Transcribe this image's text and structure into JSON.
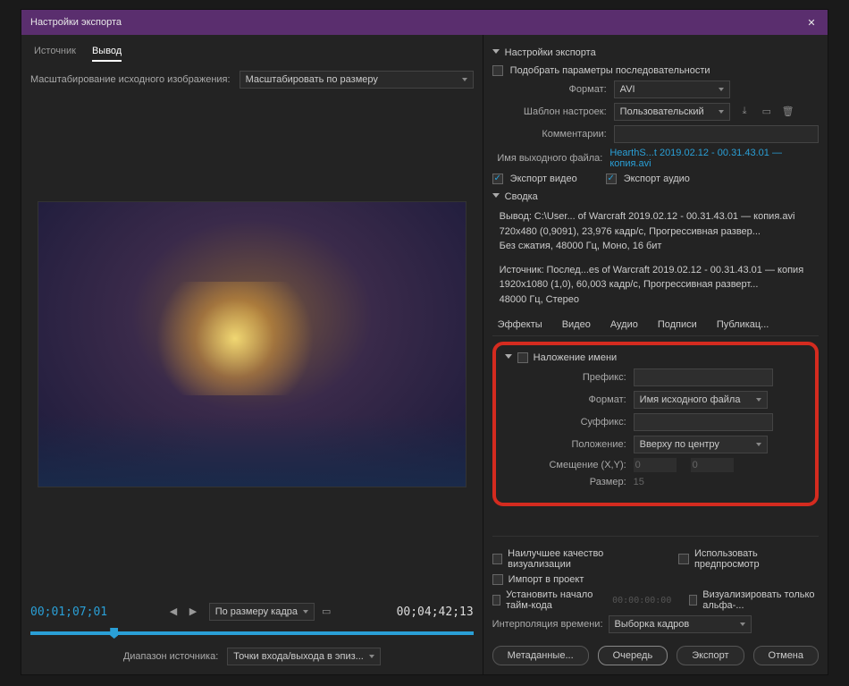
{
  "title": "Настройки экспорта",
  "close_glyph": "✕",
  "left": {
    "tabs": {
      "source": "Источник",
      "output": "Вывод"
    },
    "scale_label": "Масштабирование исходного изображения:",
    "scale_value": "Масштабировать по размеру",
    "time_in": "00;01;07;01",
    "time_out": "00;04;42;13",
    "fit_label": "По размеру кадра",
    "range_label": "Диапазон источника:",
    "range_value": "Точки входа/выхода в эпиз...",
    "play_back": "◀",
    "play_fwd": "▶"
  },
  "right": {
    "hdr": "Настройки экспорта",
    "match_seq": "Подобрать параметры последовательности",
    "format_label": "Формат:",
    "format_value": "AVI",
    "preset_label": "Шаблон настроек:",
    "preset_value": "Пользовательский",
    "comments_label": "Комментарии:",
    "outname_label": "Имя выходного файла:",
    "outname_value": "HearthS...t 2019.02.12 - 00.31.43.01 — копия.avi",
    "export_video": "Экспорт видео",
    "export_audio": "Экспорт аудио",
    "summary_hdr": "Сводка",
    "summary_out_label": "Вывод:",
    "summary_out": "C:\\User... of Warcraft 2019.02.12 - 00.31.43.01 — копия.avi\n720x480 (0,9091), 23,976 кадр/с, Прогрессивная развер...\nБез сжатия, 48000 Гц, Моно, 16 бит",
    "summary_src_label": "Источник:",
    "summary_src": "Послед...es of Warcraft 2019.02.12 - 00.31.43.01 — копия\n1920x1080 (1,0), 60,003 кадр/с, Прогрессивная разверт...\n48000 Гц, Стерео",
    "tabs2": {
      "effects": "Эффекты",
      "video": "Видео",
      "audio": "Аудио",
      "captions": "Подписи",
      "publish": "Публикац..."
    },
    "name_overlay": {
      "hdr": "Наложение имени",
      "prefix": "Префикс:",
      "format": "Формат:",
      "format_value": "Имя исходного файла",
      "suffix": "Суффикс:",
      "position": "Положение:",
      "position_value": "Вверху по центру",
      "offset": "Смещение (X,Y):",
      "offset_x": "0",
      "offset_y": "0",
      "size": "Размер:",
      "size_value": "15"
    },
    "bottom": {
      "best_quality": "Наилучшее качество визуализации",
      "use_preview": "Использовать предпросмотр",
      "import_project": "Импорт в проект",
      "set_tc": "Установить начало тайм-кода",
      "tc_value": "00:00:00:00",
      "render_alpha": "Визуализировать только альфа-...",
      "interp_label": "Интерполяция времени:",
      "interp_value": "Выборка кадров"
    },
    "buttons": {
      "metadata": "Метаданные...",
      "queue": "Очередь",
      "export": "Экспорт",
      "cancel": "Отмена"
    }
  }
}
